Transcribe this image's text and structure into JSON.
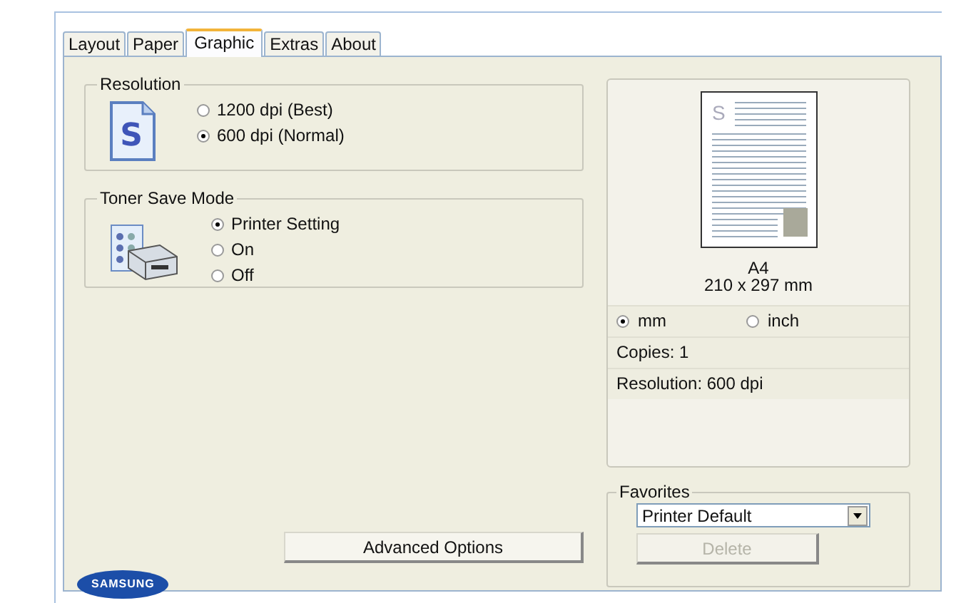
{
  "tabs": [
    {
      "label": "Layout",
      "selected": false
    },
    {
      "label": "Paper",
      "selected": false
    },
    {
      "label": "Graphic",
      "selected": true
    },
    {
      "label": "Extras",
      "selected": false
    },
    {
      "label": "About",
      "selected": false
    }
  ],
  "resolution": {
    "title": "Resolution",
    "icon_letter": "S",
    "options": [
      {
        "label": "1200 dpi (Best)",
        "selected": false
      },
      {
        "label": "600 dpi (Normal)",
        "selected": true
      }
    ]
  },
  "toner_save_mode": {
    "title": "Toner Save Mode",
    "options": [
      {
        "label": "Printer Setting",
        "selected": true
      },
      {
        "label": "On",
        "selected": false
      },
      {
        "label": "Off",
        "selected": false
      }
    ]
  },
  "advanced_button": "Advanced Options",
  "logo": "SAMSUNG",
  "preview": {
    "page_letter": "S",
    "paper": "A4",
    "size": "210 x 297 mm",
    "units": [
      {
        "label": "mm",
        "selected": true
      },
      {
        "label": "inch",
        "selected": false
      }
    ],
    "copies": "Copies: 1",
    "resolution": "Resolution: 600 dpi"
  },
  "favorites": {
    "title": "Favorites",
    "value": "Printer Default",
    "delete_button": {
      "label": "Delete",
      "disabled": true
    }
  }
}
